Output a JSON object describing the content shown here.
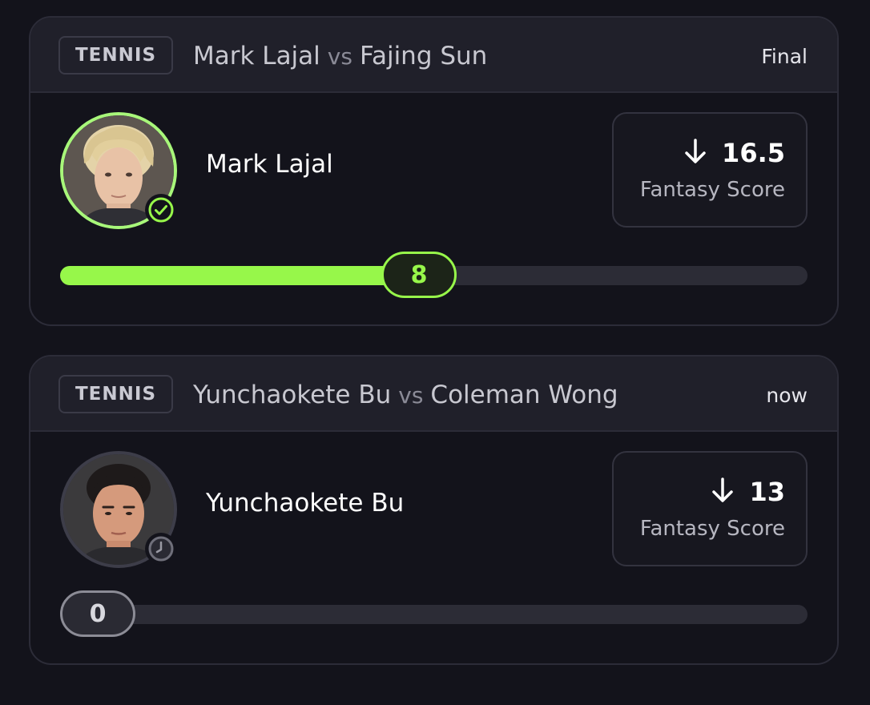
{
  "cards": [
    {
      "sport": "TENNIS",
      "player_a": "Mark Lajal",
      "vs": "vs",
      "player_b": "Fajing Sun",
      "status": "Final",
      "player_name": "Mark Lajal",
      "player_badge_icon": "check-circle-icon",
      "score_direction_icon": "arrow-down-icon",
      "score_value": "16.5",
      "score_label": "Fantasy Score",
      "progress_value": "8",
      "progress_fraction": 0.48,
      "accent_color": "#97f74a"
    },
    {
      "sport": "TENNIS",
      "player_a": "Yunchaokete Bu",
      "vs": "vs",
      "player_b": "Coleman Wong",
      "status": "now",
      "player_name": "Yunchaokete Bu",
      "player_badge_icon": "clock-icon",
      "score_direction_icon": "arrow-down-icon",
      "score_value": "13",
      "score_label": "Fantasy Score",
      "progress_value": "0",
      "progress_fraction": 0.0,
      "accent_color": "#8c8c96"
    }
  ]
}
